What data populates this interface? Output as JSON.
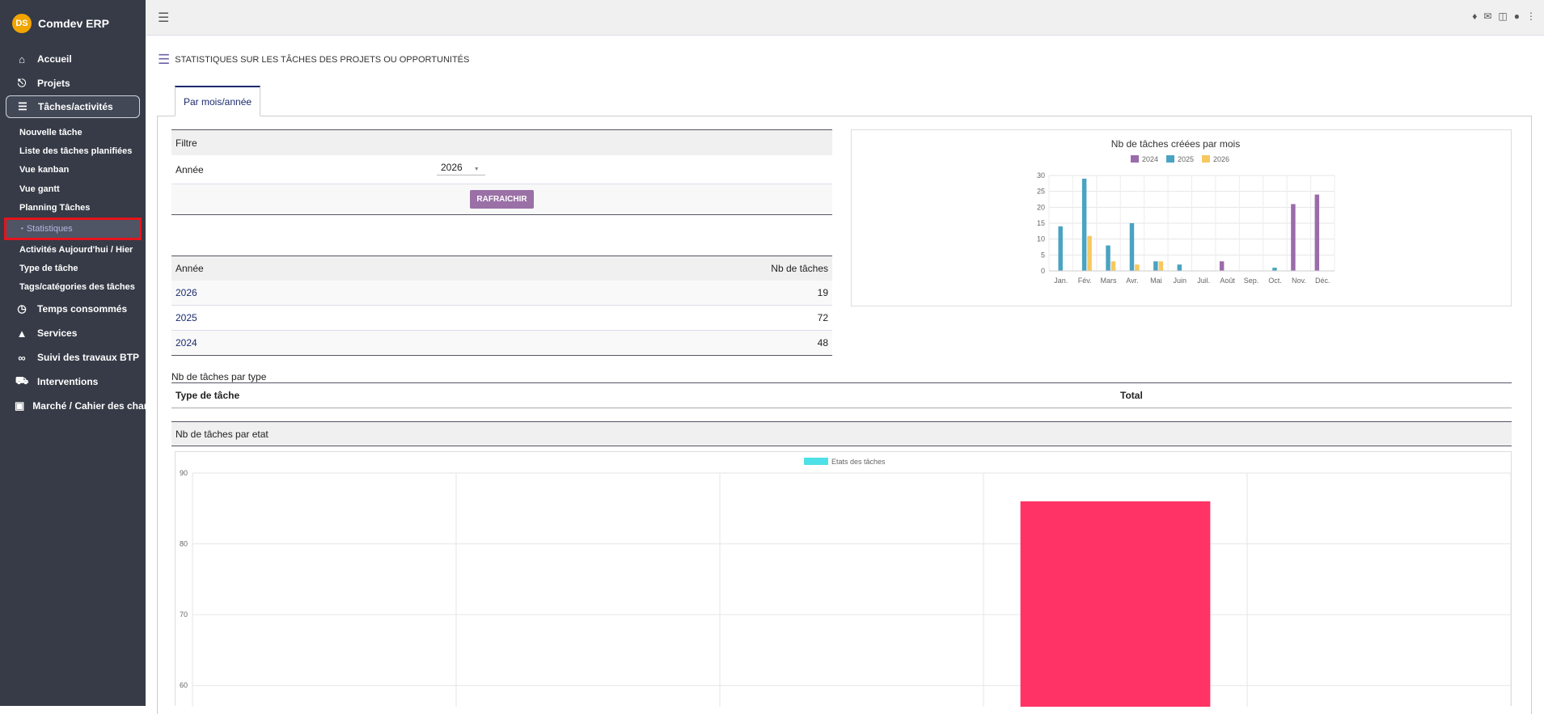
{
  "app": {
    "title": "Comdev ERP",
    "logo_text": "DS"
  },
  "sidebar": {
    "top_items": [
      {
        "label": "Accueil",
        "icon": "home-icon"
      },
      {
        "label": "Projets",
        "icon": "project-tree-icon"
      },
      {
        "label": "Tâches/activités",
        "icon": "task-list-icon"
      }
    ],
    "sub_items": [
      "Nouvelle tâche",
      "Liste des tâches planifiées",
      "Vue kanban",
      "Vue gantt",
      "Planning Tâches",
      "Statistiques",
      "Activités Aujourd'hui / Hier",
      "Type de tâche",
      "Tags/catégories des tâches"
    ],
    "selected_sub_prefix": "•",
    "bottom_items": [
      {
        "label": "Temps consommés",
        "icon": "clock-icon"
      },
      {
        "label": "Services",
        "icon": "service-bell-icon"
      },
      {
        "label": "Suivi des travaux BTP",
        "icon": "binoculars-icon"
      },
      {
        "label": "Interventions",
        "icon": "truck-icon"
      },
      {
        "label": "Marché / Cahier des charg",
        "icon": "book-icon"
      }
    ]
  },
  "topbar": {
    "icons": [
      "hamburger-icon",
      "bell-icon",
      "chat-icon",
      "trash-icon",
      "user-avatar-icon",
      "more-vert-icon"
    ]
  },
  "page": {
    "title": "STATISTIQUES SUR LES TÂCHES DES PROJETS OU OPPORTUNITÉS",
    "tab": "Par mois/année"
  },
  "filter": {
    "heading": "Filtre",
    "year_label": "Année",
    "year_value": "2026",
    "button": "RAFRAICHIR"
  },
  "year_table": {
    "headers": [
      "Année",
      "Nb de tâches"
    ],
    "rows": [
      [
        "2026",
        "19"
      ],
      [
        "2025",
        "72"
      ],
      [
        "2024",
        "48"
      ]
    ]
  },
  "type_section": {
    "label": "Nb de tâches par type",
    "headers": [
      "Type de tâche",
      "Total"
    ]
  },
  "etat_section": {
    "label": "Nb de tâches par etat"
  },
  "chart_data": [
    {
      "type": "bar",
      "title": "Nb de tâches créées par mois",
      "categories": [
        "Jan.",
        "Fév.",
        "Mars",
        "Avr.",
        "Mai",
        "Juin",
        "Juil.",
        "Août",
        "Sep.",
        "Oct.",
        "Nov.",
        "Déc."
      ],
      "series": [
        {
          "name": "2024",
          "color": "#9b6bab",
          "values": [
            0,
            0,
            0,
            0,
            0,
            0,
            0,
            3,
            0,
            0,
            21,
            24
          ]
        },
        {
          "name": "2025",
          "color": "#4aa3c2",
          "values": [
            14,
            29,
            8,
            15,
            3,
            2,
            0,
            0,
            0,
            1,
            0,
            0
          ]
        },
        {
          "name": "2026",
          "color": "#f6c85f",
          "values": [
            0,
            11,
            3,
            2,
            3,
            0,
            0,
            0,
            0,
            0,
            0,
            0
          ]
        }
      ],
      "ylim": [
        0,
        30
      ],
      "yticks": [
        0,
        5,
        10,
        15,
        20,
        25,
        30
      ],
      "legend": "top",
      "grid": true
    },
    {
      "type": "bar",
      "categories": [
        "",
        "",
        "",
        "",
        ""
      ],
      "series": [
        {
          "name": "Etats des tâches",
          "color": "#4de0e6",
          "values": [
            null,
            null,
            null,
            86,
            null
          ],
          "bar_colors": [
            "",
            "",
            "",
            "#ff3366",
            ""
          ]
        }
      ],
      "yticks": [
        60,
        70,
        80,
        90
      ],
      "ylim_visible": [
        57,
        90
      ],
      "legend": "top",
      "grid": true
    }
  ]
}
